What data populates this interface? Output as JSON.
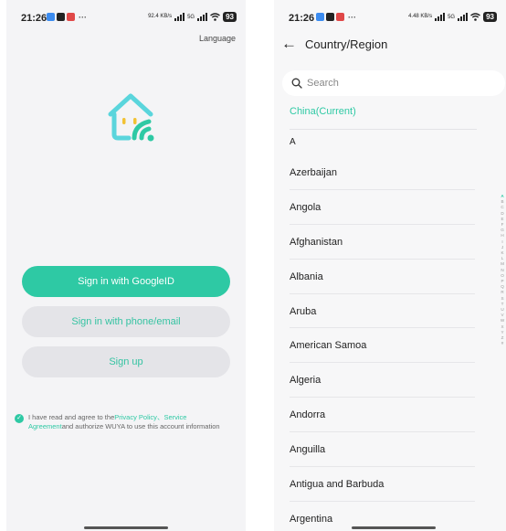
{
  "left": {
    "status": {
      "time": "21:26",
      "network": "92.4 KB/s",
      "cell": "5G",
      "battery": "93"
    },
    "language_label": "Language",
    "buttons": {
      "google": "Sign in with GoogleID",
      "phone_email": "Sign in with phone/email",
      "signup": "Sign up"
    },
    "agreement": {
      "prefix": "I have read and agree to the",
      "privacy": "Privacy Policy",
      "sep": "、",
      "service": "Service Agreement",
      "suffix": "and authorize WUYA to use this account information"
    }
  },
  "right": {
    "status": {
      "time": "21:26",
      "network": "4.48 KB/s",
      "cell": "5G",
      "battery": "93"
    },
    "title": "Country/Region",
    "search_placeholder": "Search",
    "current": "China(Current)",
    "section_letter": "A",
    "countries": [
      "Azerbaijan",
      "Angola",
      "Afghanistan",
      "Albania",
      "Aruba",
      "American Samoa",
      "Algeria",
      "Andorra",
      "Anguilla",
      "Antigua and Barbuda",
      "Argentina"
    ],
    "alphabet": [
      "A",
      "B",
      "C",
      "D",
      "E",
      "F",
      "G",
      "H",
      "I",
      "J",
      "K",
      "L",
      "M",
      "N",
      "O",
      "P",
      "Q",
      "R",
      "S",
      "T",
      "U",
      "V",
      "W",
      "X",
      "Y",
      "Z",
      "#"
    ],
    "alphabet_active": "A"
  },
  "colors": {
    "accent": "#2ec9a4",
    "button_secondary_bg": "#e4e4e8",
    "screen_bg": "#f4f4f6"
  },
  "icons": {
    "back": "arrow-left-icon",
    "search": "search-icon",
    "logo": "smiling-house-wifi-logo",
    "check": "check-circle-icon"
  }
}
